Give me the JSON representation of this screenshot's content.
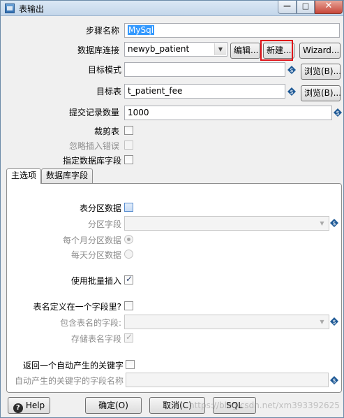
{
  "window": {
    "title": "表输出",
    "minimize_glyph": "—",
    "maximize_glyph": "□",
    "close_glyph": "✕"
  },
  "form": {
    "step_name": {
      "label": "步骤名称",
      "value": "MySql"
    },
    "db_connection": {
      "label": "数据库连接",
      "value": "newyb_patient",
      "edit_button": "编辑...",
      "new_button": "新建...",
      "wizard_button": "Wizard..."
    },
    "target_schema": {
      "label": "目标模式",
      "value": "",
      "browse_button": "浏览(B)..."
    },
    "target_table": {
      "label": "目标表",
      "value": "t_patient_fee",
      "browse_button": "浏览(B)..."
    },
    "commit_size": {
      "label": "提交记录数量",
      "value": "1000"
    },
    "truncate_table": {
      "label": "裁剪表",
      "checked": false
    },
    "ignore_insert_errors": {
      "label": "忽略插入错误",
      "checked": false,
      "disabled": true
    },
    "specify_db_fields": {
      "label": "指定数据库字段",
      "checked": false
    }
  },
  "tabs": [
    {
      "label": "主选项",
      "active": true
    },
    {
      "label": "数据库字段",
      "active": false
    }
  ],
  "main_options": {
    "partition_data": {
      "label": "表分区数据",
      "checked": false
    },
    "partition_field": {
      "label": "分区字段",
      "value": ""
    },
    "partition_monthly": {
      "label": "每个月分区数据",
      "selected": true
    },
    "partition_daily": {
      "label": "每天分区数据",
      "selected": false
    },
    "batch_insert": {
      "label": "使用批量插入",
      "checked": true
    },
    "table_name_in_field": {
      "label": "表名定义在一个字段里?",
      "checked": false
    },
    "table_name_field": {
      "label": "包含表名的字段:",
      "value": ""
    },
    "store_table_name": {
      "label": "存储表名字段",
      "checked": true
    },
    "return_generated_key": {
      "label": "返回一个自动产生的关键字",
      "checked": false
    },
    "generated_key_field": {
      "label": "自动产生的关键字的字段名称",
      "value": ""
    }
  },
  "footer": {
    "help": "Help",
    "ok": "确定(O)",
    "cancel": "取消(C)",
    "sql": "SQL",
    "watermark": "https://blog.csdn.net/xm393392625"
  },
  "icons": {
    "variable": "variable-dollar-icon",
    "dropdown": "chevron-down-icon",
    "check": "check-icon"
  },
  "colors": {
    "accent": "#3399ff",
    "highlight_border": "#e0141a",
    "variable_icon": "#1f5a96"
  }
}
